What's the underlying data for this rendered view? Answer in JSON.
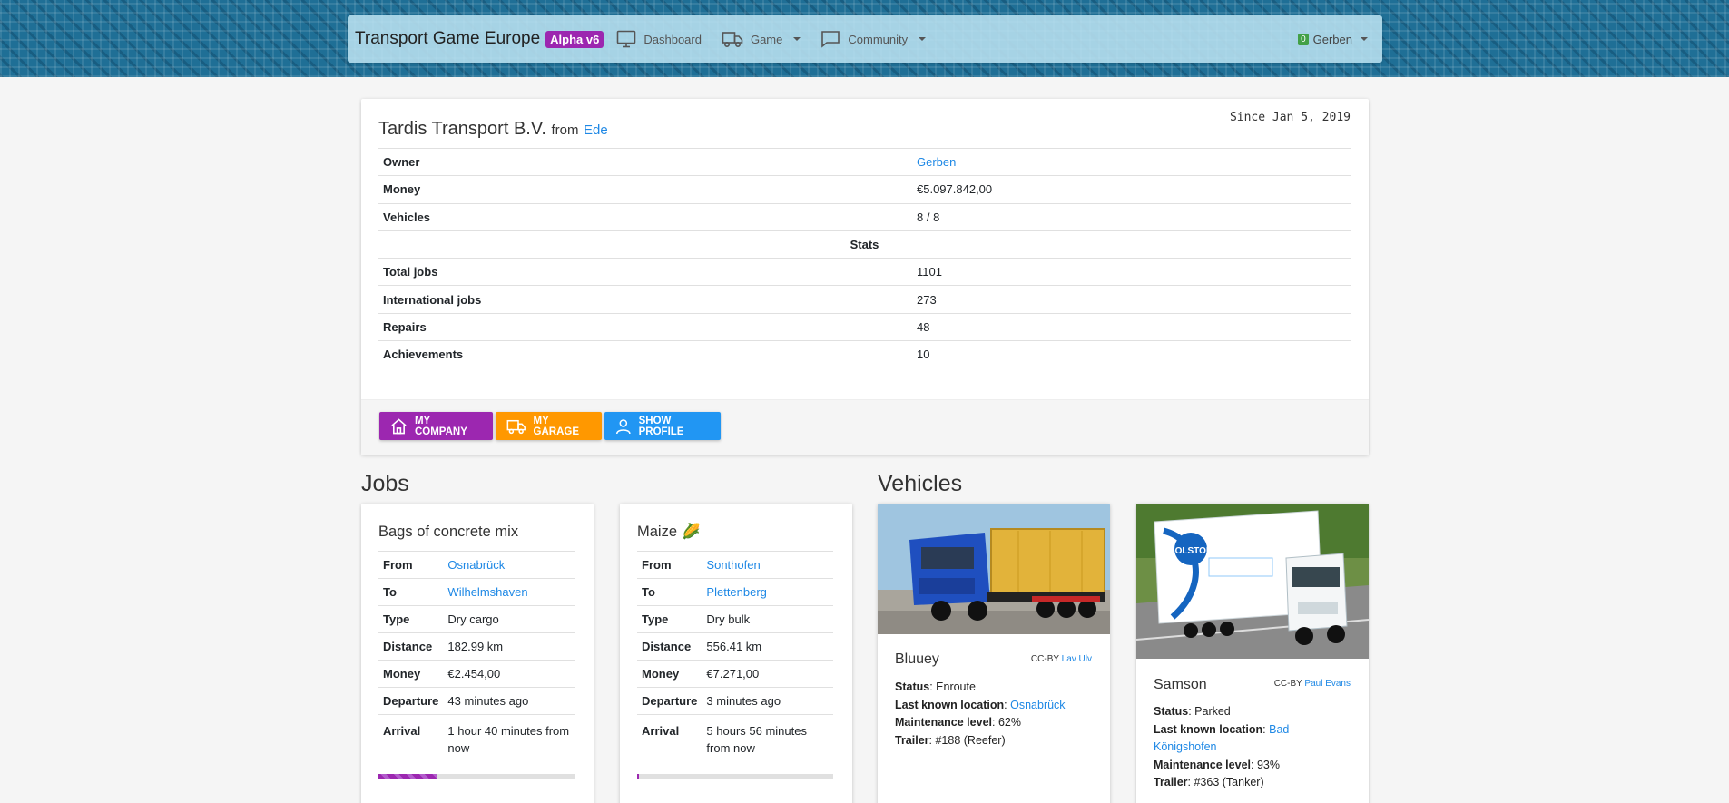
{
  "nav": {
    "brand": "Transport Game Europe",
    "version_badge": "Alpha v6",
    "items": [
      {
        "label": "Dashboard",
        "icon": "monitor-icon"
      },
      {
        "label": "Game",
        "icon": "truck-icon"
      },
      {
        "label": "Community",
        "icon": "chat-bubble-icon"
      }
    ],
    "user": {
      "badge": "0",
      "name": "Gerben"
    }
  },
  "company": {
    "name": "Tardis Transport B.V.",
    "from_label": "from",
    "city": "Ede",
    "since": "Since Jan 5, 2019",
    "rows": [
      {
        "key": "Owner",
        "value": "Gerben",
        "link": true
      },
      {
        "key": "Money",
        "value": "€5.097.842,00"
      },
      {
        "key": "Vehicles",
        "value": "8 / 8"
      }
    ],
    "stats_label": "Stats",
    "stats": [
      {
        "key": "Total jobs",
        "value": "1101"
      },
      {
        "key": "International jobs",
        "value": "273"
      },
      {
        "key": "Repairs",
        "value": "48"
      },
      {
        "key": "Achievements",
        "value": "10"
      }
    ],
    "buttons": {
      "my_company": "My Company",
      "my_garage": "My Garage",
      "show_profile": "Show Profile"
    }
  },
  "sections": {
    "jobs": "Jobs",
    "vehicles": "Vehicles"
  },
  "jobs": [
    {
      "title": "Bags of concrete mix",
      "emoji": "",
      "from": "Osnabrück",
      "to": "Wilhelmshaven",
      "type": "Dry cargo",
      "distance": "182.99 km",
      "money": "€2.454,00",
      "departure": "43 minutes ago",
      "arrival": "1 hour 40 minutes from now",
      "progress": 0.3
    },
    {
      "title": "Maize",
      "emoji": "🌽",
      "from": "Sonthofen",
      "to": "Plettenberg",
      "type": "Dry bulk",
      "distance": "556.41 km",
      "money": "€7.271,00",
      "departure": "3 minutes ago",
      "arrival": "5 hours 56 minutes from now",
      "progress": 0.01
    }
  ],
  "job_labels": {
    "from": "From",
    "to": "To",
    "type": "Type",
    "distance": "Distance",
    "money": "Money",
    "departure": "Departure",
    "arrival": "Arrival"
  },
  "vehicles": [
    {
      "name": "Bluuey",
      "credit_prefix": "CC-BY",
      "credit_author": "Lav Ulv",
      "status": "Enroute",
      "location": "Osnabrück",
      "maintenance": "62%",
      "trailer": "#188 (Reefer)"
    },
    {
      "name": "Samson",
      "credit_prefix": "CC-BY",
      "credit_author": "Paul Evans",
      "status": "Parked",
      "location": "Bad Königshofen",
      "maintenance": "93%",
      "trailer": "#363 (Tanker)"
    }
  ],
  "vehicle_labels": {
    "status": "Status",
    "location": "Last known location",
    "maintenance": "Maintenance level",
    "trailer": "Trailer"
  },
  "truck_photo_logo": "SOLSTOR",
  "colors": {
    "purple": "#9c27b0",
    "orange": "#ff9800",
    "blue": "#2196f3",
    "link": "#1e88e5"
  }
}
